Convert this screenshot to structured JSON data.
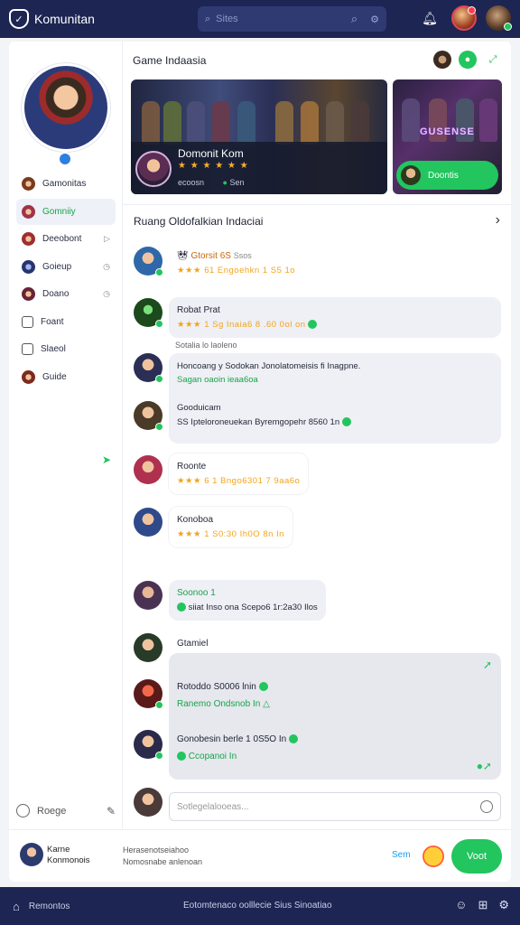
{
  "topbar": {
    "brand": "Komunitan",
    "search_placeholder": "Sites"
  },
  "sidebar": {
    "items": [
      {
        "label": "Gamonitas",
        "active": false
      },
      {
        "label": "Gomniiy",
        "active": true
      },
      {
        "label": "Deeobont",
        "active": false
      },
      {
        "label": "Goieup",
        "active": false
      },
      {
        "label": "Doano",
        "active": false
      },
      {
        "label": "Foant",
        "active": false
      },
      {
        "label": "Slaeol",
        "active": false
      },
      {
        "label": "Guide",
        "active": false
      }
    ],
    "footer_label": "Roege"
  },
  "main": {
    "section_title": "Game Indaasia",
    "banner": {
      "title": "Domonit Kom",
      "stars": "★ ★ ★ ★ ★ ★",
      "meta_left": "ecoosn",
      "meta_right": "Sen"
    },
    "banner2": {
      "logo_text": "GUSENSE",
      "button_label": "Doontis"
    },
    "room_title": "Ruang Oldofalkian Indaciai",
    "messages": [
      {
        "name": "Gtorsit 6S",
        "suffix": "Ssos",
        "line": "★★★ 61 Engoehkn 1 S5 1o"
      },
      {
        "name": "Robat Prat",
        "line": "★★★ 1 Sg Inaia6 8 .60 0ol on"
      },
      {
        "name": "",
        "line1": "Honcoang y Sodokan Jonolatomeisis fi Inagpne.",
        "line2": "Sagan oaoin ieaa6oa"
      },
      {
        "name": "Gooduicam",
        "line": "SS Ipteloroneuekan Byremgopehr 8560 1n"
      },
      {
        "name": "Roonte",
        "line": "★★★ 6 1 Bngo6301 7 9aa6o"
      },
      {
        "name": "Konoboa",
        "line": "★★★ 1 S0:30 Ih0O 8n In"
      },
      {
        "name": "Soonoo 1",
        "line": "siiat Inso ona Scepo6 1r:2a30 Ilos"
      },
      {
        "name": "Gtamiel",
        "line": ""
      },
      {
        "name": "Rotoddo S0006 lnin",
        "line": "Ranemo Ondsnob In"
      },
      {
        "name": "Gonobesin berle 1 0S5O In",
        "line": "Ccopanoi In"
      }
    ],
    "sub_label": "Sotalia lo laoleno",
    "composer_placeholder": "Sotlegelalooeas..."
  },
  "footer": {
    "name_line1": "Karne",
    "name_line2": "Konmonois",
    "text_line1": "Herasenotseiahoo",
    "text_line2": "Nomosnabe anlenoan",
    "link": "Sem",
    "button": "Voot"
  },
  "bottombar": {
    "left_label": "Remontos",
    "center_text": "Eotomtenaco oolllecie Sius Sinoatiao"
  }
}
